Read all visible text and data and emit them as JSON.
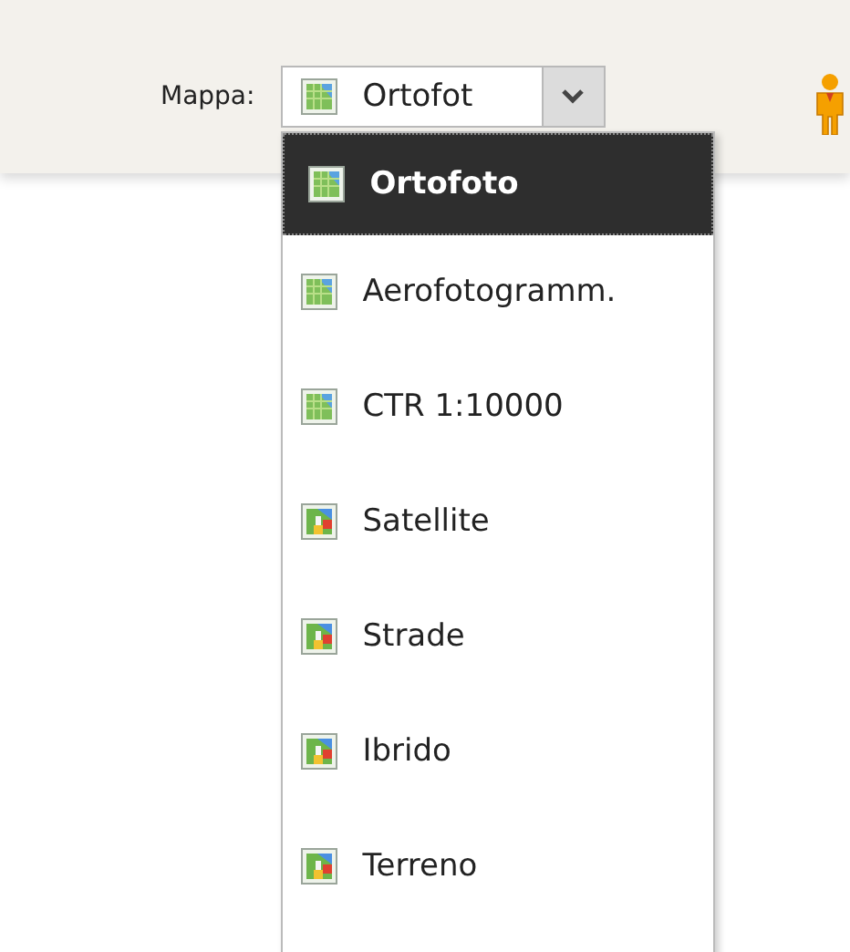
{
  "toolbar": {
    "label": "Mappa:",
    "combo": {
      "value": "Ortofot",
      "kind": "tile"
    }
  },
  "menu": {
    "items": [
      {
        "label": "Ortofoto",
        "kind": "tile",
        "selected": true
      },
      {
        "label": "Aerofotogramm.",
        "kind": "tile",
        "selected": false
      },
      {
        "label": "CTR 1:10000",
        "kind": "tile",
        "selected": false
      },
      {
        "label": "Satellite",
        "kind": "google",
        "selected": false
      },
      {
        "label": "Strade",
        "kind": "google",
        "selected": false
      },
      {
        "label": "Ibrido",
        "kind": "google",
        "selected": false
      },
      {
        "label": "Terreno",
        "kind": "google",
        "selected": false
      }
    ]
  }
}
